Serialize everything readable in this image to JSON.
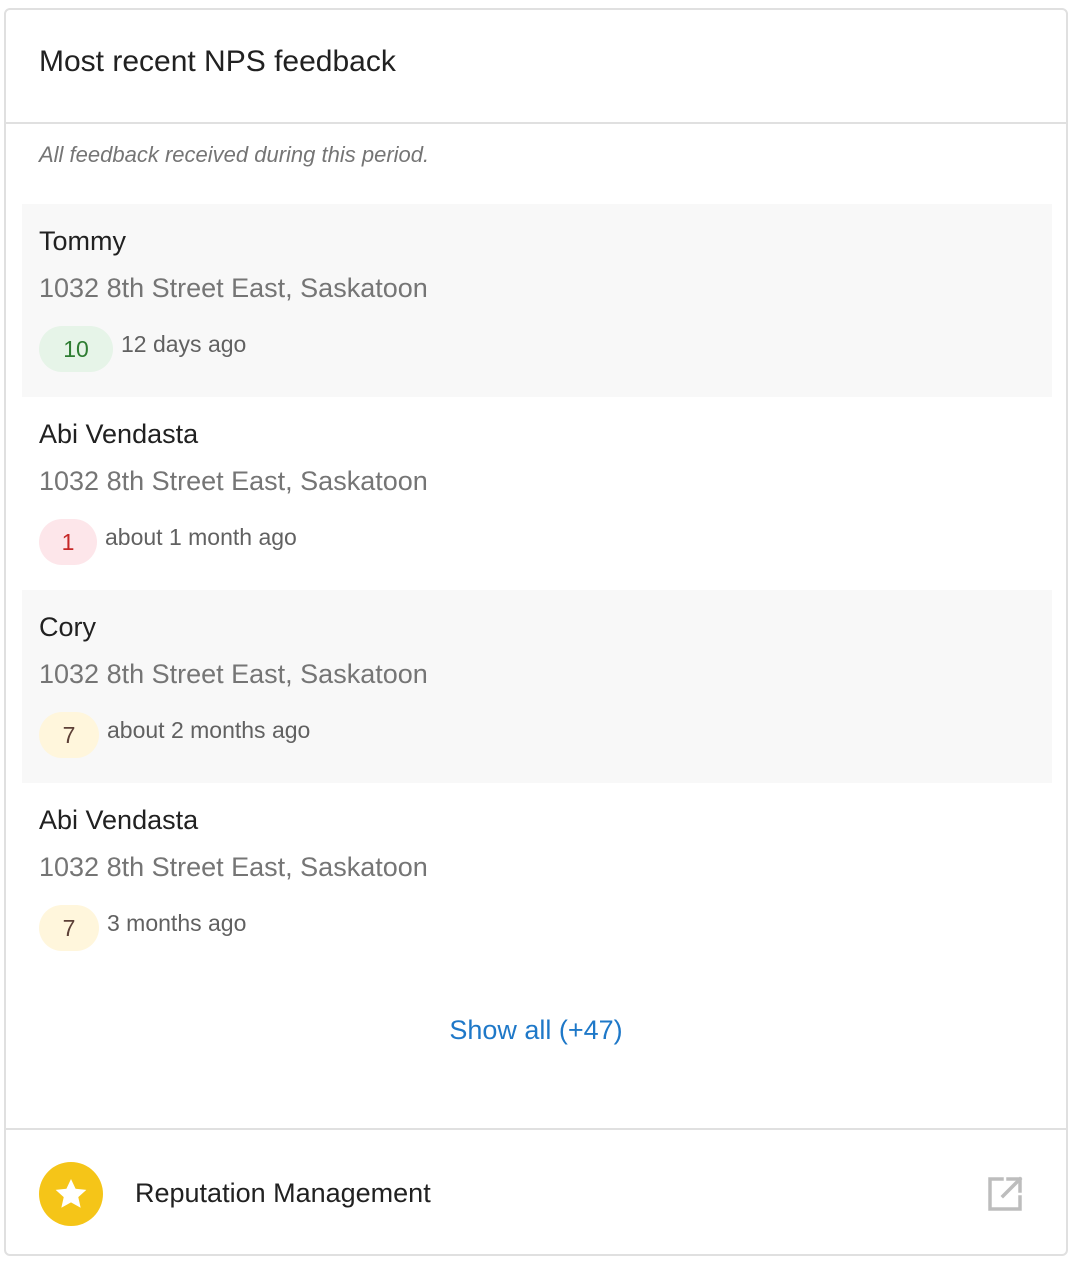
{
  "card": {
    "title": "Most recent NPS feedback",
    "subtitle": "All feedback received during this period."
  },
  "feedback": [
    {
      "name": "Tommy",
      "address": "1032 8th Street East, Saskatoon",
      "score": "10",
      "category": "promoter",
      "time": "12 days ago"
    },
    {
      "name": "Abi Vendasta",
      "address": "1032 8th Street East, Saskatoon",
      "score": "1",
      "category": "detractor",
      "time": "about 1 month ago"
    },
    {
      "name": "Cory",
      "address": "1032 8th Street East, Saskatoon",
      "score": "7",
      "category": "passive",
      "time": "about 2 months ago"
    },
    {
      "name": "Abi Vendasta",
      "address": "1032 8th Street East, Saskatoon",
      "score": "7",
      "category": "passive",
      "time": "3 months ago"
    }
  ],
  "show_all_label": "Show all (+47)",
  "footer": {
    "label": "Reputation Management",
    "app_icon": "star-icon",
    "action_icon": "open-in-new-icon"
  },
  "colors": {
    "promoter_bg": "#e6f4e8",
    "promoter_text": "#2e7d32",
    "detractor_bg": "#fde6ea",
    "detractor_text": "#c62828",
    "passive_bg": "#fff6dc",
    "passive_text": "#5d4037",
    "link": "#1e78c8",
    "star_badge": "#f5c518"
  }
}
